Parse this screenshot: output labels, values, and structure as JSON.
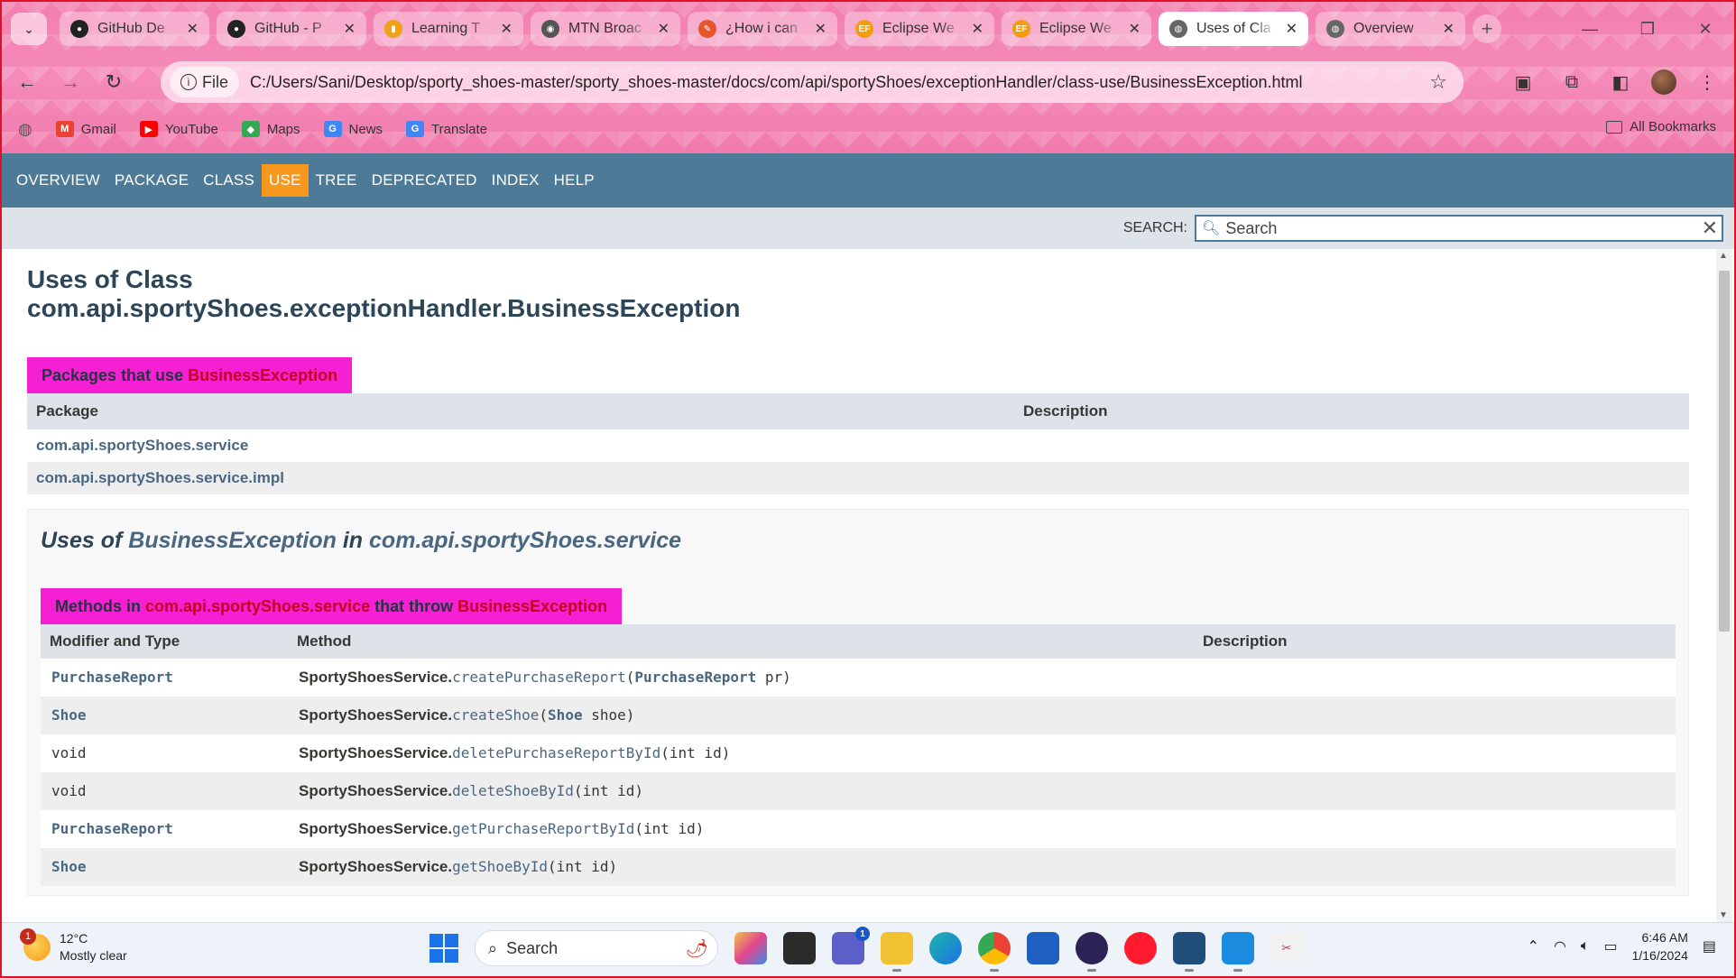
{
  "browser": {
    "tabs": [
      {
        "title": "GitHub De",
        "favicon": "github-icon",
        "active": false
      },
      {
        "title": "GitHub - P",
        "favicon": "github-icon",
        "active": false
      },
      {
        "title": "Learning T",
        "favicon": "chart-icon",
        "active": false
      },
      {
        "title": "MTN Broac",
        "favicon": "mtn-icon",
        "active": false
      },
      {
        "title": "¿How i can",
        "favicon": "pencil-icon",
        "active": false
      },
      {
        "title": "Eclipse We",
        "favicon": "ef-icon",
        "active": false
      },
      {
        "title": "Eclipse We",
        "favicon": "ef-icon",
        "active": false
      },
      {
        "title": "Uses of Cla",
        "favicon": "globe-icon",
        "active": true
      },
      {
        "title": "Overview",
        "favicon": "globe-icon",
        "active": false
      }
    ],
    "omnibox": {
      "scheme_label": "File",
      "url": "C:/Users/Sani/Desktop/sporty_shoes-master/sporty_shoes-master/docs/com/api/sportyShoes/exceptionHandler/class-use/BusinessException.html"
    },
    "bookmarks": [
      {
        "label": "Gmail",
        "icon": "gmail-icon"
      },
      {
        "label": "YouTube",
        "icon": "youtube-icon"
      },
      {
        "label": "Maps",
        "icon": "maps-icon"
      },
      {
        "label": "News",
        "icon": "news-icon"
      },
      {
        "label": "Translate",
        "icon": "translate-icon"
      }
    ],
    "all_bookmarks_label": "All Bookmarks"
  },
  "javadoc": {
    "nav": [
      "OVERVIEW",
      "PACKAGE",
      "CLASS",
      "USE",
      "TREE",
      "DEPRECATED",
      "INDEX",
      "HELP"
    ],
    "current_nav": "USE",
    "search_label": "SEARCH:",
    "search_placeholder": "Search",
    "title_line1": "Uses of Class",
    "title_line2": "com.api.sportyShoes.exceptionHandler.BusinessException",
    "packages_caption_prefix": "Packages that use ",
    "packages_caption_class": "BusinessException",
    "packages_header": {
      "package": "Package",
      "description": "Description"
    },
    "packages": [
      {
        "name": "com.api.sportyShoes.service",
        "description": ""
      },
      {
        "name": "com.api.sportyShoes.service.impl",
        "description": ""
      }
    ],
    "section": {
      "heading_uses": "Uses of ",
      "heading_class": "BusinessException",
      "heading_in": " in ",
      "heading_package": "com.api.sportyShoes.service",
      "methods_caption_prefix": "Methods in ",
      "methods_caption_package": "com.api.sportyShoes.service",
      "methods_caption_mid": " that throw ",
      "methods_caption_class": "BusinessException",
      "header": {
        "modifier": "Modifier and Type",
        "method": "Method",
        "description": "Description"
      },
      "rows": [
        {
          "type": "PurchaseReport",
          "type_link": true,
          "cls": "SportyShoesService.",
          "method": "createPurchaseReport",
          "params_pre": "(",
          "param_type": "PurchaseReport",
          "params_post": " pr)"
        },
        {
          "type": "Shoe",
          "type_link": true,
          "cls": "SportyShoesService.",
          "method": "createShoe",
          "params_pre": "(",
          "param_type": "Shoe",
          "params_post": " shoe)"
        },
        {
          "type": "void",
          "type_link": false,
          "cls": "SportyShoesService.",
          "method": "deletePurchaseReportById",
          "params_pre": "(int id)",
          "param_type": "",
          "params_post": ""
        },
        {
          "type": "void",
          "type_link": false,
          "cls": "SportyShoesService.",
          "method": "deleteShoeById",
          "params_pre": "(int id)",
          "param_type": "",
          "params_post": ""
        },
        {
          "type": "PurchaseReport",
          "type_link": true,
          "cls": "SportyShoesService.",
          "method": "getPurchaseReportById",
          "params_pre": "(int id)",
          "param_type": "",
          "params_post": ""
        },
        {
          "type": "Shoe",
          "type_link": true,
          "cls": "SportyShoesService.",
          "method": "getShoeById",
          "params_pre": "(int id)",
          "param_type": "",
          "params_post": ""
        }
      ]
    }
  },
  "taskbar": {
    "weather_temp": "12°C",
    "weather_desc": "Mostly clear",
    "weather_badge": "1",
    "search_label": "Search",
    "chat_badge": "1",
    "time": "6:46 AM",
    "date": "1/16/2024"
  }
}
